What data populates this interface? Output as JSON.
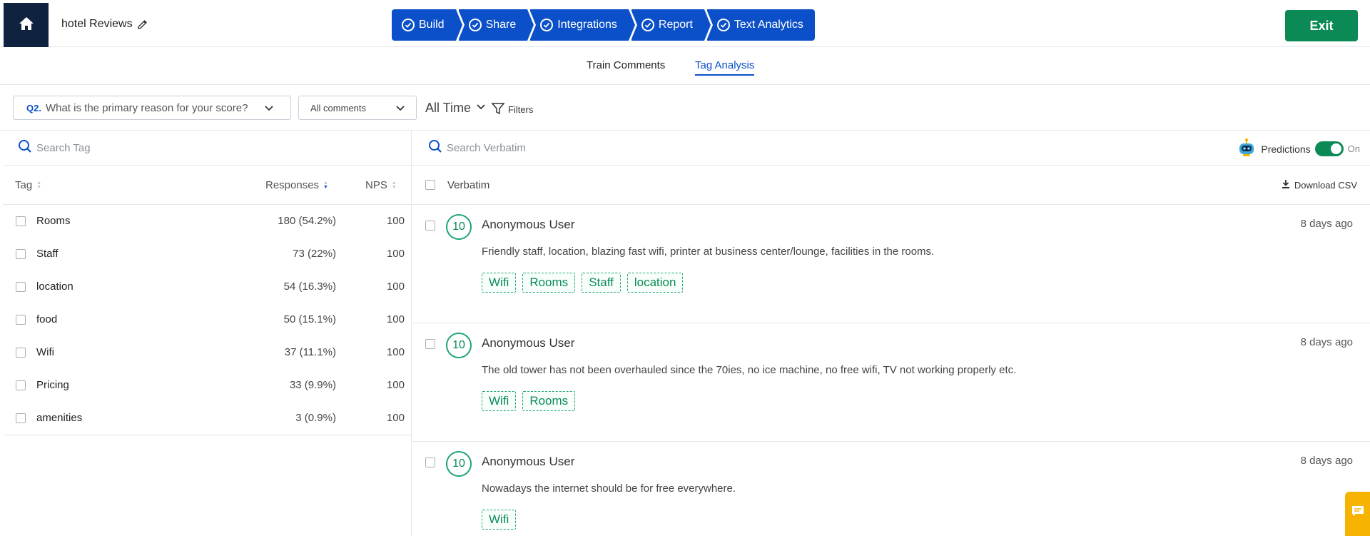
{
  "header": {
    "survey_title": "hotel Reviews",
    "steps": [
      {
        "label": "Build"
      },
      {
        "label": "Share"
      },
      {
        "label": "Integrations"
      },
      {
        "label": "Report"
      },
      {
        "label": "Text Analytics"
      }
    ],
    "exit_label": "Exit"
  },
  "subtabs": [
    {
      "label": "Train Comments",
      "active": false
    },
    {
      "label": "Tag Analysis",
      "active": true
    }
  ],
  "filters": {
    "question_number": "Q2.",
    "question_text": "What is the primary reason for your score?",
    "comments_select": "All comments",
    "time_select": "All Time",
    "filters_label": "Filters"
  },
  "tags_panel": {
    "search_placeholder": "Search Tag",
    "columns": {
      "tag": "Tag",
      "responses": "Responses",
      "nps": "NPS"
    },
    "rows": [
      {
        "name": "Rooms",
        "responses": "180 (54.2%)",
        "nps": "100"
      },
      {
        "name": "Staff",
        "responses": "73 (22%)",
        "nps": "100"
      },
      {
        "name": "location",
        "responses": "54 (16.3%)",
        "nps": "100"
      },
      {
        "name": "food",
        "responses": "50 (15.1%)",
        "nps": "100"
      },
      {
        "name": "Wifi",
        "responses": "37 (11.1%)",
        "nps": "100"
      },
      {
        "name": "Pricing",
        "responses": "33 (9.9%)",
        "nps": "100"
      },
      {
        "name": "amenities",
        "responses": "3 (0.9%)",
        "nps": "100"
      }
    ]
  },
  "verbatim_panel": {
    "search_placeholder": "Search Verbatim",
    "predictions_label": "Predictions",
    "predictions_state": "On",
    "column_label": "Verbatim",
    "download_label": "Download CSV",
    "items": [
      {
        "score": "10",
        "user": "Anonymous User",
        "ago": "8 days ago",
        "text": "Friendly staff, location, blazing fast wifi, printer at business center/lounge, facilities in the rooms.",
        "tags": [
          "Wifi",
          "Rooms",
          "Staff",
          "location"
        ]
      },
      {
        "score": "10",
        "user": "Anonymous User",
        "ago": "8 days ago",
        "text": "The old tower has not been overhauled since the 70ies, no ice machine, no free wifi, TV not working properly etc.",
        "tags": [
          "Wifi",
          "Rooms"
        ]
      },
      {
        "score": "10",
        "user": "Anonymous User",
        "ago": "8 days ago",
        "text": "Nowadays the internet should be for free everywhere.",
        "tags": [
          "Wifi"
        ]
      }
    ]
  },
  "colors": {
    "primary": "#0b50c9",
    "success": "#0b8a55",
    "nav_dark": "#0f2240",
    "chat": "#f6b400"
  }
}
